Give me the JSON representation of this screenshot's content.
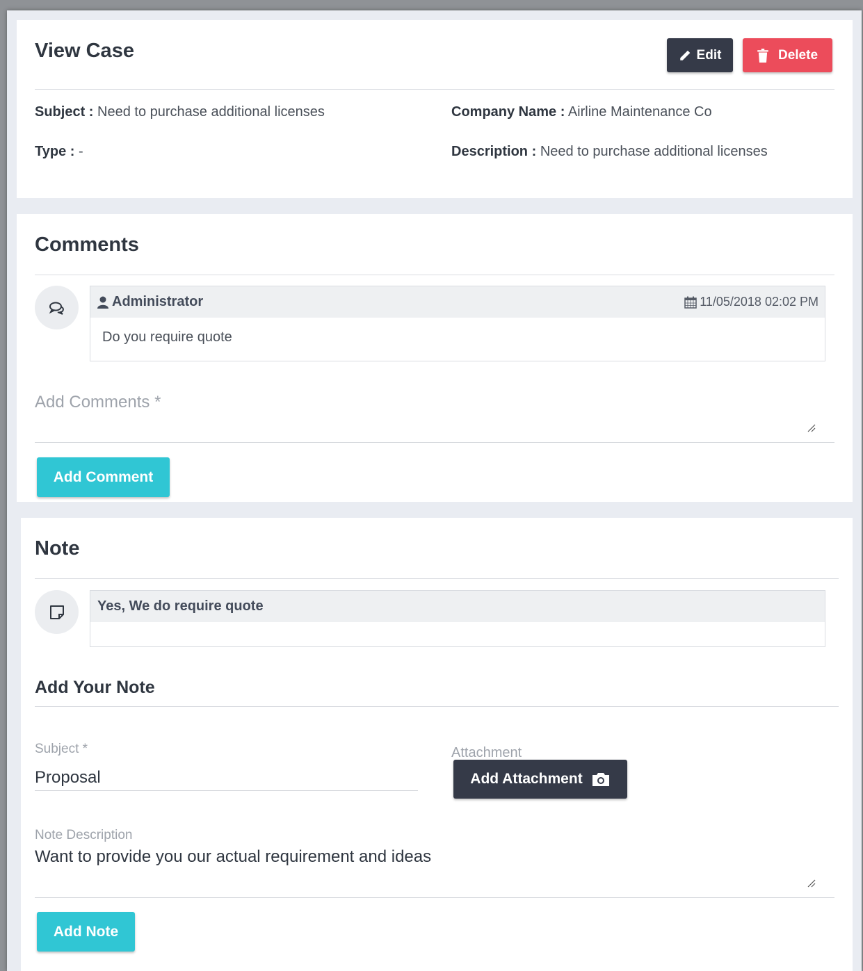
{
  "view_case": {
    "title": "View Case",
    "edit_label": "Edit",
    "delete_label": "Delete",
    "subject_label": "Subject :",
    "subject_value": "Need to purchase additional licenses",
    "type_label": "Type :",
    "type_value": "-",
    "company_label": "Company Name :",
    "company_value": "Airline Maintenance Co",
    "description_label": "Description :",
    "description_value": "Need to purchase additional licenses"
  },
  "comments": {
    "title": "Comments",
    "items": [
      {
        "author": "Administrator",
        "date": "11/05/2018 02:02 PM",
        "text": "Do you require quote"
      }
    ],
    "add_placeholder": "Add Comments *",
    "add_button": "Add Comment"
  },
  "note": {
    "title": "Note",
    "items": [
      {
        "text": "Yes, We do require quote"
      }
    ],
    "add_title": "Add Your Note",
    "subject_label": "Subject *",
    "subject_value": "Proposal",
    "attachment_label": "Attachment",
    "attachment_button": "Add Attachment",
    "description_label": "Note Description",
    "description_value": "Want to provide you our actual requirement and ideas",
    "add_button": "Add Note"
  },
  "colors": {
    "dark_button": "#353a48",
    "delete_button": "#ec4c5b",
    "teal_button": "#30c6d4",
    "page_background": "#e9ecf2"
  },
  "icons": {
    "edit": "pencil-icon",
    "delete": "trash-icon",
    "comment_avatar": "comments-icon",
    "author": "user-icon",
    "date": "calendar-icon",
    "note_avatar": "sticky-note-icon",
    "attachment": "camera-icon"
  }
}
